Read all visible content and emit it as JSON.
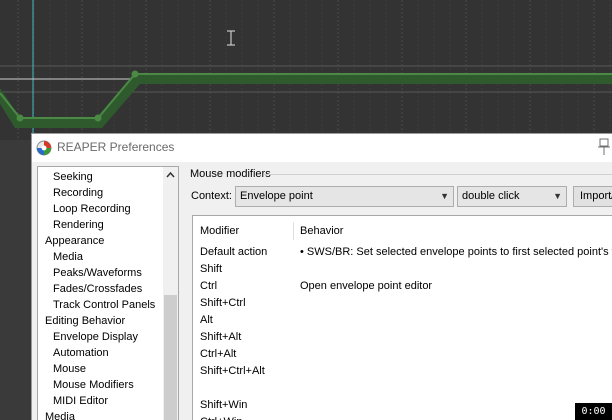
{
  "window": {
    "title": "REAPER Preferences"
  },
  "colors": {
    "envelope": "#4a8a44",
    "envelope_band": "#2e5a2e",
    "daw_background": "#333333"
  },
  "tree": {
    "items": [
      {
        "label": "Seeking",
        "indent": 2
      },
      {
        "label": "Recording",
        "indent": 2
      },
      {
        "label": "Loop Recording",
        "indent": 2
      },
      {
        "label": "Rendering",
        "indent": 2
      },
      {
        "label": "Appearance",
        "indent": 1
      },
      {
        "label": "Media",
        "indent": 2
      },
      {
        "label": "Peaks/Waveforms",
        "indent": 2
      },
      {
        "label": "Fades/Crossfades",
        "indent": 2
      },
      {
        "label": "Track Control Panels",
        "indent": 2
      },
      {
        "label": "Editing Behavior",
        "indent": 1
      },
      {
        "label": "Envelope Display",
        "indent": 2
      },
      {
        "label": "Automation",
        "indent": 2
      },
      {
        "label": "Mouse",
        "indent": 2
      },
      {
        "label": "Mouse Modifiers",
        "indent": 2
      },
      {
        "label": "MIDI Editor",
        "indent": 2
      },
      {
        "label": "Media",
        "indent": 1
      }
    ]
  },
  "mouse_modifiers": {
    "section_title": "Mouse modifiers",
    "context_label": "Context:",
    "context_value": "Envelope point",
    "action_value": "double click",
    "import_label": "Import/export..."
  },
  "table": {
    "columns": [
      "Modifier",
      "Behavior"
    ],
    "rows": [
      {
        "modifier": "Default action",
        "behavior": "• SWS/BR: Set selected envelope points to first selected point's value"
      },
      {
        "modifier": "Shift",
        "behavior": ""
      },
      {
        "modifier": "Ctrl",
        "behavior": "Open envelope point editor"
      },
      {
        "modifier": "Shift+Ctrl",
        "behavior": ""
      },
      {
        "modifier": "Alt",
        "behavior": ""
      },
      {
        "modifier": "Shift+Alt",
        "behavior": ""
      },
      {
        "modifier": "Ctrl+Alt",
        "behavior": ""
      },
      {
        "modifier": "Shift+Ctrl+Alt",
        "behavior": ""
      },
      {
        "modifier": "",
        "behavior": ""
      },
      {
        "modifier": "Shift+Win",
        "behavior": ""
      },
      {
        "modifier": "Ctrl+Win",
        "behavior": ""
      }
    ]
  },
  "overlay": {
    "timecode": "0:00"
  }
}
